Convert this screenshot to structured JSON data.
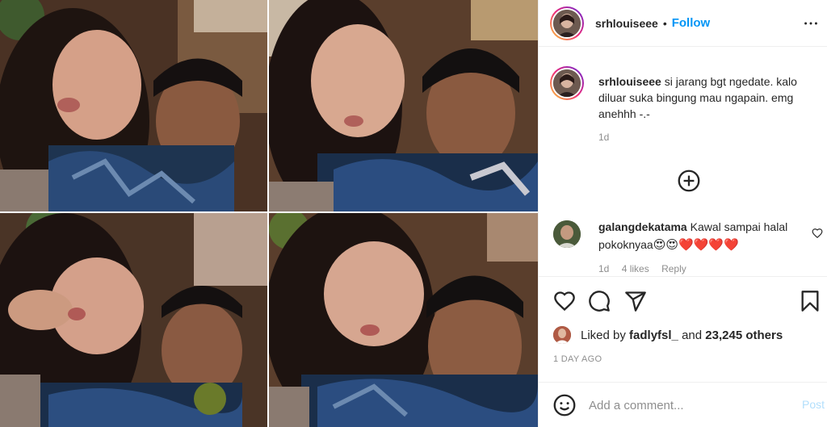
{
  "post": {
    "username": "srhlouiseee",
    "separator": "•",
    "follow_label": "Follow",
    "caption_text": "si jarang bgt ngedate. kalo diluar suka bingung mau ngapain. emg anehhh -.-",
    "caption_time": "1d"
  },
  "comments": [
    {
      "username": "galangdekatama",
      "text": "Kawal sampai halal pokoknyaa",
      "emojis": "😍😍❤️❤️❤️❤️",
      "time": "1d",
      "likes": "4 likes",
      "reply_label": "Reply"
    }
  ],
  "likes": {
    "prefix": "Liked by",
    "user": "fadlyfsl_",
    "conjunction": "and",
    "others": "23,245 others"
  },
  "timestamp": "1 DAY AGO",
  "add_comment": {
    "placeholder": "Add a comment...",
    "post_label": "Post"
  },
  "icons": {
    "more": "more-horizontal-icon",
    "load_more": "plus-circle-icon",
    "like": "heart-outline-icon",
    "comment": "comment-bubble-icon",
    "share": "paper-plane-icon",
    "save": "bookmark-icon",
    "emoji": "smiley-face-icon"
  },
  "colors": {
    "link_blue": "#0095f6",
    "post_disabled": "#b2dffc",
    "muted_gray": "#8e8e8e",
    "text_dark": "#262626"
  }
}
